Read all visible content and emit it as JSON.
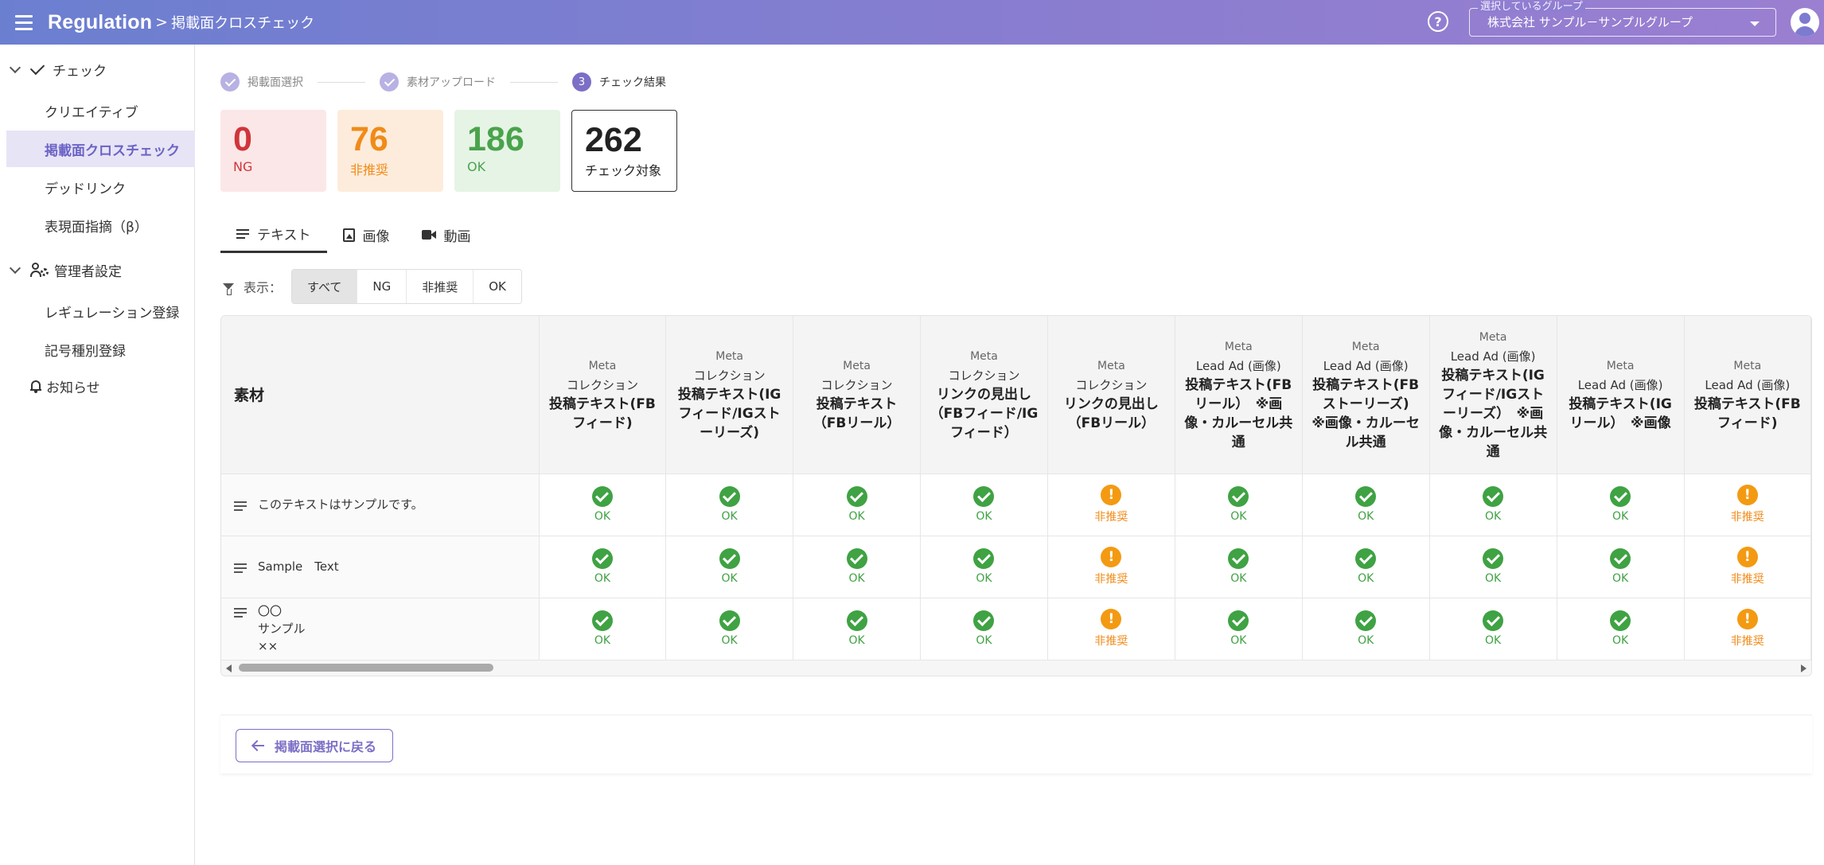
{
  "header": {
    "brand": "Regulation",
    "separator": ">",
    "breadcrumb": "掲載面クロスチェック",
    "help_glyph": "?",
    "group_legend": "選択しているグループ",
    "group_value": "株式会社 サンプル－サンプルグループ"
  },
  "sidebar": {
    "check_group": "チェック",
    "items": [
      "クリエイティブ",
      "掲載面クロスチェック",
      "デッドリンク",
      "表現面指摘（β）"
    ],
    "admin_group": "管理者設定",
    "admin_items": [
      "レギュレーション登録",
      "記号種別登録"
    ],
    "notice": "お知らせ"
  },
  "stepper": {
    "steps": [
      {
        "label": "掲載面選択",
        "state": "done"
      },
      {
        "label": "素材アップロード",
        "state": "done"
      },
      {
        "number": "3",
        "label": "チェック結果",
        "state": "active"
      }
    ]
  },
  "counts": {
    "ng": {
      "value": "0",
      "label": "NG"
    },
    "warn": {
      "value": "76",
      "label": "非推奨"
    },
    "ok": {
      "value": "186",
      "label": "OK"
    },
    "total": {
      "value": "262",
      "label": "チェック対象"
    }
  },
  "tabs": [
    "テキスト",
    "画像",
    "動画"
  ],
  "filter": {
    "label": "表示：",
    "options": [
      "すべて",
      "NG",
      "非推奨",
      "OK"
    ],
    "selected": "すべて"
  },
  "table": {
    "first_header": "素材",
    "columns": [
      {
        "platform": "Meta",
        "type": "コレクション",
        "placement": "投稿テキスト(FBフィード)"
      },
      {
        "platform": "Meta",
        "type": "コレクション",
        "placement": "投稿テキスト(IGフィード/IGストーリーズ)"
      },
      {
        "platform": "Meta",
        "type": "コレクション",
        "placement": "投稿テキスト（FBリール）"
      },
      {
        "platform": "Meta",
        "type": "コレクション",
        "placement": "リンクの見出し（FBフィード/IGフィード）"
      },
      {
        "platform": "Meta",
        "type": "コレクション",
        "placement": "リンクの見出し（FBリール）"
      },
      {
        "platform": "Meta",
        "type": "Lead Ad (画像)",
        "placement": "投稿テキスト(FBリール）　※画像・カルーセル共通"
      },
      {
        "platform": "Meta",
        "type": "Lead Ad (画像)",
        "placement": "投稿テキスト(FBストーリーズ)　※画像・カルーセル共通"
      },
      {
        "platform": "Meta",
        "type": "Lead Ad (画像)",
        "placement": "投稿テキスト(IGフィード/IGストーリーズ）　※画像・カルーセル共通"
      },
      {
        "platform": "Meta",
        "type": "Lead Ad (画像)",
        "placement": "投稿テキスト(IGリール）　※画像"
      },
      {
        "platform": "Meta",
        "type": "Lead Ad (画像)",
        "placement": "投稿テキスト(FBフィード)"
      }
    ],
    "status_labels": {
      "ok": "OK",
      "warn": "非推奨"
    },
    "warn_glyph": "!",
    "rows": [
      {
        "lines": [
          "このテキストはサンプルです。"
        ],
        "statuses": [
          "ok",
          "ok",
          "ok",
          "ok",
          "warn",
          "ok",
          "ok",
          "ok",
          "ok",
          "warn"
        ]
      },
      {
        "lines": [
          "Sample　Text"
        ],
        "statuses": [
          "ok",
          "ok",
          "ok",
          "ok",
          "warn",
          "ok",
          "ok",
          "ok",
          "ok",
          "warn"
        ]
      },
      {
        "lines": [
          "〇〇",
          "サンプル",
          "××"
        ],
        "statuses": [
          "ok",
          "ok",
          "ok",
          "ok",
          "warn",
          "ok",
          "ok",
          "ok",
          "ok",
          "warn"
        ]
      }
    ]
  },
  "footer": {
    "back_label": "掲載面選択に戻る"
  },
  "colors": {
    "accent": "#7b6fc6",
    "ng": "#d0353a",
    "warn": "#f08b18",
    "ok": "#3fa243"
  }
}
